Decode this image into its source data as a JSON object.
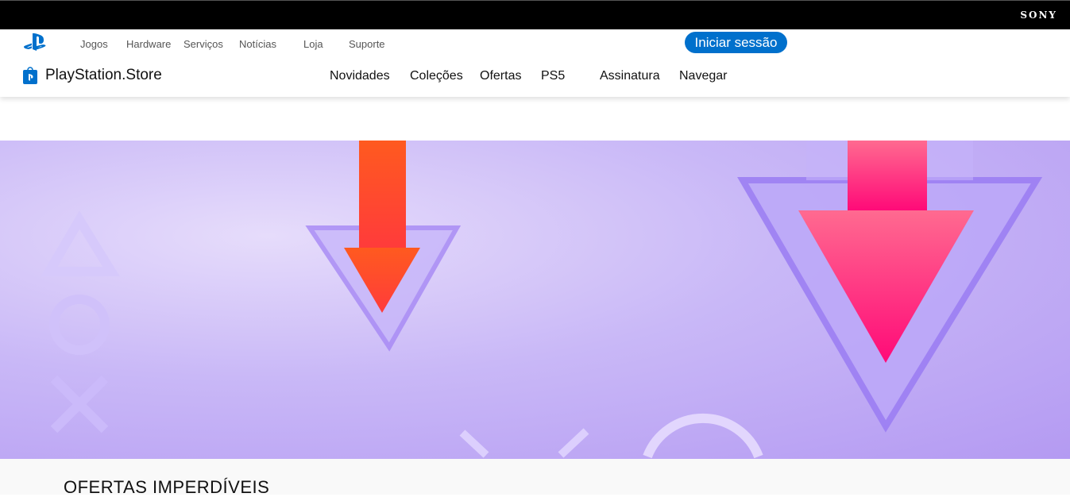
{
  "brand": "SONY",
  "global_nav": [
    "Jogos",
    "Hardware",
    "Serviços",
    "Notícias",
    "Loja",
    "Suporte"
  ],
  "signin_label": "Iniciar sessão",
  "store_name": "PlayStation.Store",
  "store_nav": [
    "Novidades",
    "Coleções",
    "Ofertas",
    "PS5",
    "Assinatura",
    "Navegar"
  ],
  "section_title": "OFERTAS IMPERDÍVEIS",
  "colors": {
    "accent": "#0070cc",
    "hero": "#c9b8f7"
  }
}
